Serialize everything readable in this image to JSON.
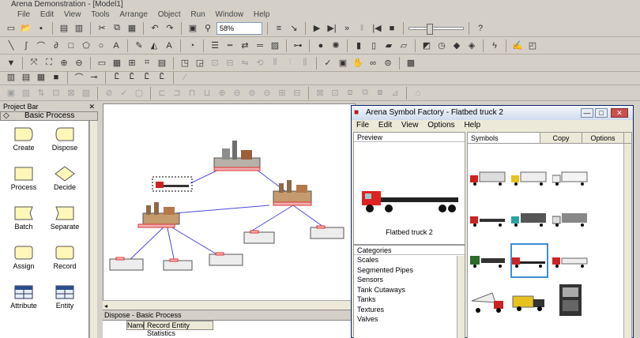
{
  "window": {
    "title": "Arena Demonstration - [Model1]"
  },
  "menu": [
    "File",
    "Edit",
    "View",
    "Tools",
    "Arrange",
    "Object",
    "Run",
    "Window",
    "Help"
  ],
  "toolbar": {
    "zoom": "58%"
  },
  "project_bar": {
    "title": "Project Bar",
    "panel": "Basic Process",
    "modules": [
      {
        "label": "Create",
        "shape": "create"
      },
      {
        "label": "Dispose",
        "shape": "dispose"
      },
      {
        "label": "Process",
        "shape": "process"
      },
      {
        "label": "Decide",
        "shape": "decide"
      },
      {
        "label": "Batch",
        "shape": "batch"
      },
      {
        "label": "Separate",
        "shape": "separate"
      },
      {
        "label": "Assign",
        "shape": "assign"
      },
      {
        "label": "Record",
        "shape": "record"
      },
      {
        "label": "Attribute",
        "shape": "table"
      },
      {
        "label": "Entity",
        "shape": "table"
      }
    ]
  },
  "bottom": {
    "title": "Dispose - Basic Process",
    "col_name": "Name",
    "col_value": "Record Entity Statistics"
  },
  "symbol_factory": {
    "title": "Arena Symbol Factory - Flatbed truck 2",
    "menu": [
      "File",
      "Edit",
      "View",
      "Options",
      "Help"
    ],
    "preview_label": "Preview",
    "preview_name": "Flatbed truck 2",
    "categories_label": "Categories",
    "categories": [
      "Scales",
      "Segmented Pipes",
      "Sensors",
      "Tank Cutaways",
      "Tanks",
      "Textures",
      "Valves"
    ],
    "tabs": {
      "symbols": "Symbols",
      "copy": "Copy",
      "options": "Options"
    },
    "min": "—",
    "max": "□",
    "close": "✕"
  },
  "colors": {
    "accent": "#3b8ed8",
    "title_bg": "#cfdcee",
    "module_fill": "#fff7b8"
  }
}
